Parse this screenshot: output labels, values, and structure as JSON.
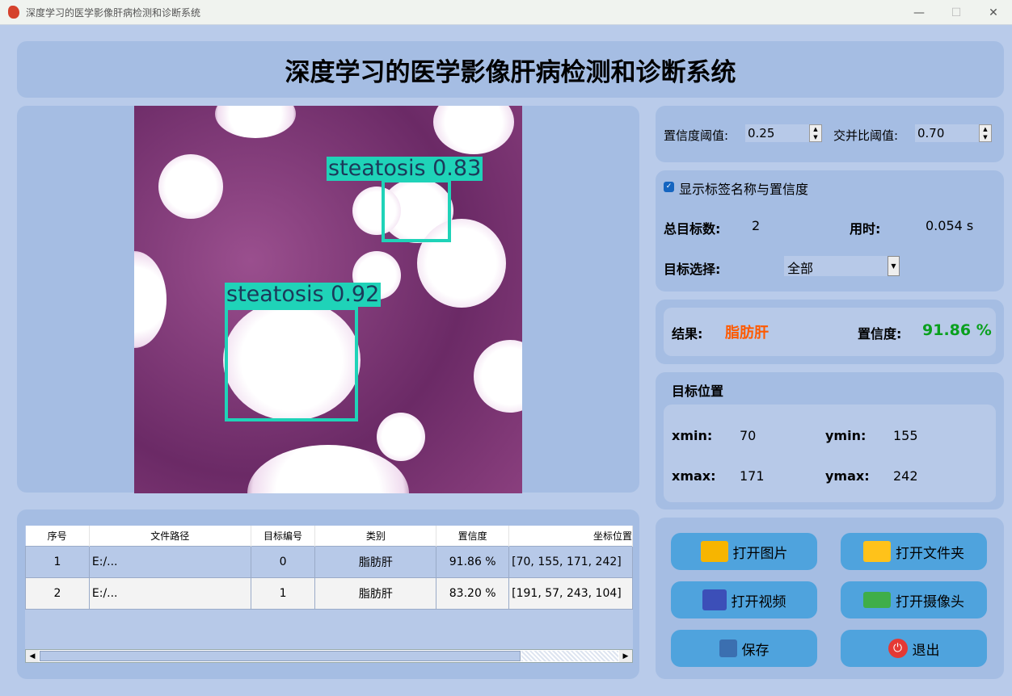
{
  "window": {
    "title": "深度学习的医学影像肝病检测和诊断系统",
    "minimize": "—",
    "maximize": "☐",
    "close": "✕"
  },
  "header": {
    "title": "深度学习的医学影像肝病检测和诊断系统"
  },
  "image": {
    "detections": [
      {
        "label": "steatosis 0.83"
      },
      {
        "label": "steatosis 0.92"
      }
    ]
  },
  "table": {
    "columns": [
      "序号",
      "文件路径",
      "目标编号",
      "类别",
      "置信度",
      "坐标位置"
    ],
    "rows": [
      [
        "1",
        "E:/...",
        "0",
        "脂肪肝",
        "91.86 %",
        "[70, 155, 171, 242]"
      ],
      [
        "2",
        "E:/...",
        "1",
        "脂肪肝",
        "83.20 %",
        "[191, 57, 243, 104]"
      ]
    ]
  },
  "settings": {
    "conf_label": "置信度阈值:",
    "conf_value": "0.25",
    "iou_label": "交并比阈值:",
    "iou_value": "0.70"
  },
  "display": {
    "show_label": "显示标签名称与置信度",
    "show_checked": true,
    "total_label": "总目标数:",
    "total_value": "2",
    "time_label": "用时:",
    "time_value": "0.054 s",
    "select_label": "目标选择:",
    "select_value": "全部"
  },
  "result": {
    "label": "结果:",
    "value": "脂肪肝",
    "conf_label": "置信度:",
    "conf_value": "91.86 %",
    "value_color": "#ff5a00",
    "conf_color": "#0aa01e"
  },
  "position": {
    "title": "目标位置",
    "xmin_label": "xmin:",
    "xmin": "70",
    "ymin_label": "ymin:",
    "ymin": "155",
    "xmax_label": "xmax:",
    "xmax": "171",
    "ymax_label": "ymax:",
    "ymax": "242"
  },
  "buttons": {
    "open_image": "打开图片",
    "open_folder": "打开文件夹",
    "open_video": "打开视频",
    "open_camera": "打开摄像头",
    "save": "保存",
    "exit": "退出"
  }
}
